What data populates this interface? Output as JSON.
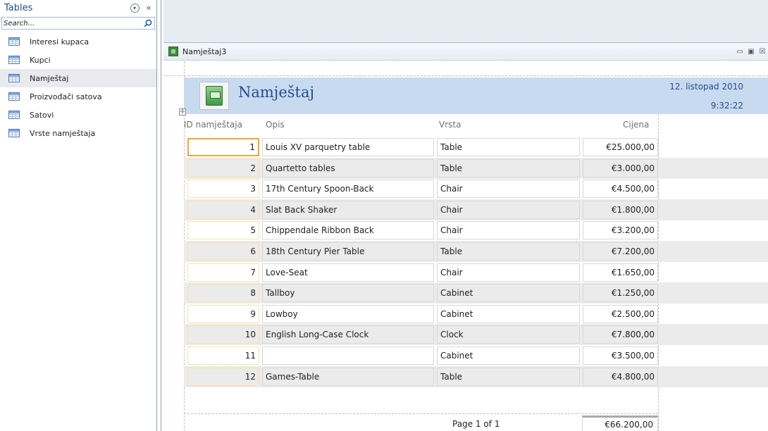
{
  "nav": {
    "title": "Tables",
    "search_placeholder": "Search...",
    "items": [
      {
        "label": "Interesi kupaca"
      },
      {
        "label": "Kupci"
      },
      {
        "label": "Namještaj",
        "selected": true
      },
      {
        "label": "Proizvođači satova"
      },
      {
        "label": "Satovi"
      },
      {
        "label": "Vrste namještaja"
      }
    ]
  },
  "document": {
    "tab_title": "Namještaj3"
  },
  "report": {
    "title": "Namještaj",
    "date": "12. listopad 2010",
    "time": "9:32:22",
    "columns": {
      "id": "ID namještaja",
      "opis": "Opis",
      "vrsta": "Vrsta",
      "cijena": "Cijena"
    },
    "rows": [
      {
        "id": "1",
        "opis": "Louis XV parquetry table",
        "vrsta": "Table",
        "cijena": "€25.000,00"
      },
      {
        "id": "2",
        "opis": "Quartetto tables",
        "vrsta": "Table",
        "cijena": "€3.000,00"
      },
      {
        "id": "3",
        "opis": "17th Century Spoon-Back",
        "vrsta": "Chair",
        "cijena": "€4.500,00"
      },
      {
        "id": "4",
        "opis": "Slat Back Shaker",
        "vrsta": "Chair",
        "cijena": "€1.800,00"
      },
      {
        "id": "5",
        "opis": "Chippendale Ribbon Back",
        "vrsta": "Chair",
        "cijena": "€3.200,00"
      },
      {
        "id": "6",
        "opis": "18th Century Pier Table",
        "vrsta": "Table",
        "cijena": "€7.200,00"
      },
      {
        "id": "7",
        "opis": "Love-Seat",
        "vrsta": "Chair",
        "cijena": "€1.650,00"
      },
      {
        "id": "8",
        "opis": "Tallboy",
        "vrsta": "Cabinet",
        "cijena": "€1.250,00"
      },
      {
        "id": "9",
        "opis": "Lowboy",
        "vrsta": "Cabinet",
        "cijena": "€2.500,00"
      },
      {
        "id": "10",
        "opis": "English Long-Case Clock",
        "vrsta": "Clock",
        "cijena": "€7.800,00"
      },
      {
        "id": "11",
        "opis": "",
        "vrsta": "Cabinet",
        "cijena": "€3.500,00"
      },
      {
        "id": "12",
        "opis": "Games-Table",
        "vrsta": "Table",
        "cijena": "€4.800,00"
      }
    ],
    "total": "€66.200,00",
    "pager": "Page 1 of 1"
  },
  "colors": {
    "accent_text": "#1f4e8c",
    "header_band": "#c8daf0",
    "alt_row": "#ebebeb",
    "focus_border": "#f4a53a"
  },
  "icons": {
    "nav_collapse": "collapse-pane-icon",
    "nav_options": "circle-chevron-icon",
    "search": "search-icon",
    "table": "table-icon",
    "report": "report-icon"
  }
}
